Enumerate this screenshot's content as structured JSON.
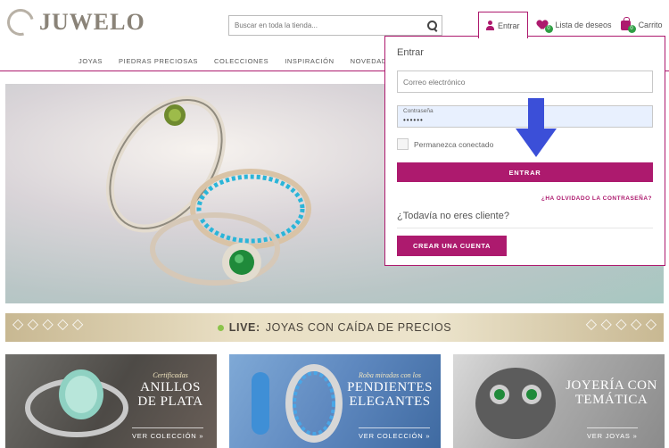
{
  "brand": {
    "name": "JUWELO"
  },
  "search": {
    "placeholder": "Buscar en toda la tienda..."
  },
  "header": {
    "enter_label": "Entrar",
    "wishlist_label": "Lista de deseos",
    "wishlist_count": "0",
    "cart_label": "Carrito",
    "cart_count": "0"
  },
  "nav": {
    "items": [
      "JOYAS",
      "PIEDRAS PRECIOSAS",
      "COLECCIONES",
      "INSPIRACIÓN",
      "NOVEDADES"
    ]
  },
  "login": {
    "title": "Entrar",
    "email_placeholder": "Correo electrónico",
    "password_label": "Contraseña",
    "password_value": "••••••",
    "remember_label": "Permanezca conectado",
    "submit_label": "ENTRAR",
    "forgot_label": "¿HA OLVIDADO LA CONTRASEÑA?",
    "not_client_label": "¿Todavía no eres cliente?",
    "create_label": "CREAR UNA CUENTA"
  },
  "live_banner": {
    "strong": "LIVE:",
    "text": "JOYAS CON CAÍDA DE PRECIOS"
  },
  "promos": [
    {
      "sub": "Certificadas",
      "title_1": "ANILLOS",
      "title_2": "DE PLATA",
      "cta": "VER COLECCIÓN »"
    },
    {
      "sub": "Roba miradas con los",
      "title_1": "PENDIENTES",
      "title_2": "ELEGANTES",
      "cta": "VER COLECCIÓN »"
    },
    {
      "sub": "",
      "title_1": "JOYERÍA CON",
      "title_2": "TEMÁTICA",
      "cta": "VER JOYAS »"
    }
  ],
  "colors": {
    "accent": "#ad1a6e",
    "badge": "#2f9e44",
    "arrow": "#3b4fd8"
  }
}
